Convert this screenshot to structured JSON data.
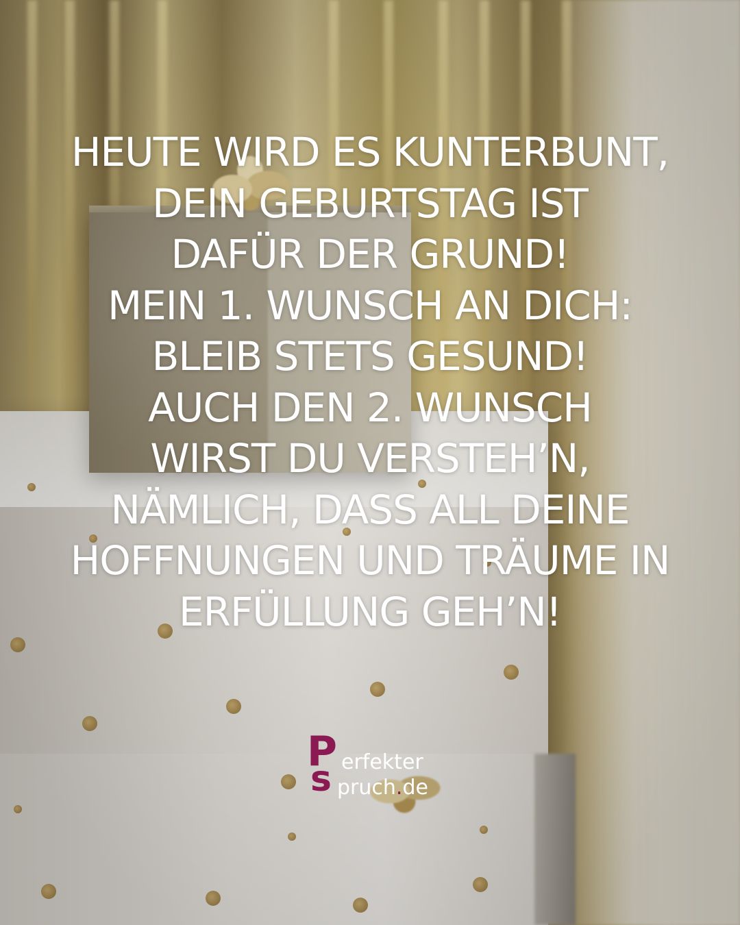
{
  "quote": {
    "lines": [
      "HEUTE WIRD ES KUNTERBUNT,",
      "DEIN GEBURTSTAG IST",
      "DAFÜR DER GRUND!",
      "MEIN 1. WUNSCH AN DICH:",
      "BLEIB STETS GESUND!",
      "AUCH DEN 2. WUNSCH",
      "WIRST DU VERSTEH’N,",
      "NÄMLICH, DASS ALL DEINE",
      "HOFFNUNGEN UND TRÄUME IN",
      "ERFÜLLUNG GEH’N!"
    ]
  },
  "logo": {
    "initial_p": "P",
    "initial_s": "s",
    "word1": "erfekter",
    "word2_a": "pruch",
    "dot": ".",
    "word2_b": "de",
    "brand_color": "#8b1a52"
  },
  "colors": {
    "text": "#ffffff",
    "brand": "#8b1a52"
  }
}
